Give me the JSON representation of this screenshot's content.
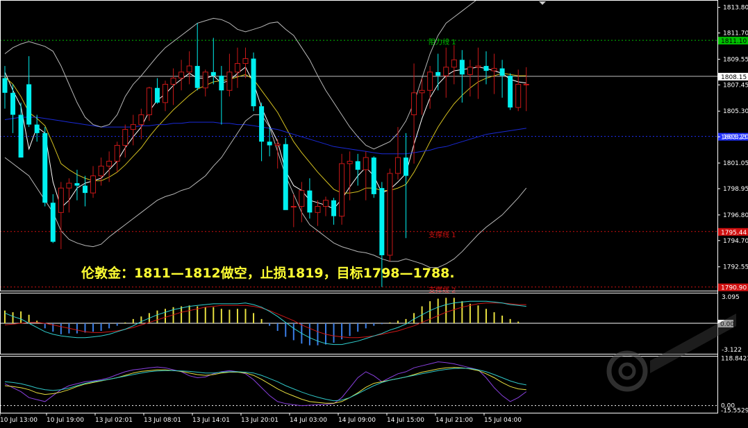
{
  "chart_data": {
    "type": "candlestick",
    "instrument_note": "伦敦金：1811—1812做空，止损1819，目标1798—1788.",
    "price_axis": {
      "ticks": [
        "1813.80",
        "1811.70",
        "1809.55",
        "1807.45",
        "1805.30",
        "1803.20",
        "1801.05",
        "1798.95",
        "1796.80",
        "1794.70",
        "1792.55"
      ],
      "ylim": [
        1790.6,
        1814.4
      ]
    },
    "time_axis": {
      "labels": [
        "10 Jul 13:00",
        "10 Jul 19:00",
        "13 Jul 02:01",
        "13 Jul 08:01",
        "13 Jul 14:01",
        "13 Jul 20:01",
        "14 Jul 03:00",
        "14 Jul 09:00",
        "14 Jul 15:00",
        "14 Jul 21:00",
        "15 Jul 04:00"
      ]
    },
    "levels": [
      {
        "name": "阻力线 1",
        "value": 1811.1,
        "label": "1811.10",
        "color": "#00c000"
      },
      {
        "name": "",
        "value": 1803.23,
        "label": "1803.23",
        "color": "#2030ff"
      },
      {
        "name": "支撑线 1",
        "value": 1795.44,
        "label": "1795.44",
        "color": "#d01010"
      },
      {
        "name": "支撑线 2",
        "value": 1790.9,
        "label": "1790.90",
        "color": "#d01010"
      }
    ],
    "current_price": {
      "value": 1808.15,
      "label": "1808.15"
    },
    "candles": [
      [
        1808.0,
        1809.0,
        1805.5,
        1806.8
      ],
      [
        1806.8,
        1807.5,
        1803.5,
        1805.0
      ],
      [
        1805.0,
        1806.0,
        1801.6,
        1801.5
      ],
      [
        1807.5,
        1809.8,
        1804.0,
        1804.2
      ],
      [
        1804.2,
        1805.0,
        1802.8,
        1803.5
      ],
      [
        1803.5,
        1804.0,
        1797.5,
        1797.8
      ],
      [
        1797.8,
        1798.5,
        1794.5,
        1794.6
      ],
      [
        1797.0,
        1799.5,
        1794.0,
        1799.0
      ],
      [
        1799.0,
        1799.8,
        1797.0,
        1799.4
      ],
      [
        1799.4,
        1800.5,
        1798.0,
        1799.2
      ],
      [
        1799.2,
        1800.0,
        1797.5,
        1798.6
      ],
      [
        1798.6,
        1800.8,
        1798.2,
        1800.0
      ],
      [
        1800.0,
        1801.5,
        1799.2,
        1800.8
      ],
      [
        1800.8,
        1802.0,
        1799.5,
        1801.2
      ],
      [
        1801.2,
        1802.8,
        1800.3,
        1802.5
      ],
      [
        1802.5,
        1804.2,
        1801.5,
        1803.8
      ],
      [
        1803.8,
        1805.0,
        1802.5,
        1804.2
      ],
      [
        1804.2,
        1805.5,
        1803.0,
        1805.0
      ],
      [
        1805.0,
        1807.3,
        1804.5,
        1807.2
      ],
      [
        1807.2,
        1808.0,
        1805.9,
        1806.0
      ],
      [
        1806.0,
        1807.8,
        1805.3,
        1807.5
      ],
      [
        1807.5,
        1808.8,
        1805.8,
        1808.0
      ],
      [
        1808.0,
        1809.5,
        1807.0,
        1808.5
      ],
      [
        1808.5,
        1810.2,
        1807.5,
        1809.0
      ],
      [
        1809.0,
        1812.5,
        1807.0,
        1807.2
      ],
      [
        1807.2,
        1808.7,
        1806.5,
        1808.5
      ],
      [
        1808.5,
        1811.3,
        1807.5,
        1808.2
      ],
      [
        1808.2,
        1809.0,
        1804.2,
        1807.0
      ],
      [
        1807.0,
        1810.0,
        1806.5,
        1808.5
      ],
      [
        1808.5,
        1810.5,
        1807.2,
        1809.2
      ],
      [
        1809.2,
        1810.5,
        1808.0,
        1809.6
      ],
      [
        1809.6,
        1810.1,
        1805.3,
        1805.7
      ],
      [
        1805.7,
        1806.0,
        1801.2,
        1802.8
      ],
      [
        1802.8,
        1804.0,
        1801.6,
        1802.5
      ],
      [
        1802.5,
        1803.0,
        1800.6,
        1802.6
      ],
      [
        1802.6,
        1803.1,
        1797.5,
        1797.2
      ],
      [
        1797.5,
        1798.5,
        1795.8,
        1797.5
      ],
      [
        1797.5,
        1799.5,
        1796.2,
        1798.8
      ],
      [
        1798.8,
        1799.8,
        1796.5,
        1797.0
      ],
      [
        1797.0,
        1798.0,
        1795.9,
        1797.5
      ],
      [
        1797.5,
        1798.3,
        1796.7,
        1798.0
      ],
      [
        1798.0,
        1798.2,
        1796.0,
        1796.7
      ],
      [
        1796.7,
        1801.8,
        1796.0,
        1801.0
      ],
      [
        1801.0,
        1802.0,
        1798.0,
        1801.2
      ],
      [
        1801.2,
        1801.8,
        1799.2,
        1800.5
      ],
      [
        1800.5,
        1802.0,
        1798.0,
        1801.5
      ],
      [
        1801.5,
        1801.6,
        1798.2,
        1798.5
      ],
      [
        1799.0,
        1799.5,
        1790.9,
        1793.5
      ],
      [
        1793.5,
        1800.6,
        1793.0,
        1800.2
      ],
      [
        1800.2,
        1804.0,
        1799.7,
        1801.5
      ],
      [
        1801.5,
        1803.5,
        1794.9,
        1800.0
      ],
      [
        1805.0,
        1809.2,
        1801.0,
        1806.8
      ],
      [
        1806.8,
        1808.0,
        1805.0,
        1807.0
      ],
      [
        1807.0,
        1809.0,
        1805.5,
        1808.5
      ],
      [
        1808.5,
        1810.0,
        1807.0,
        1808.2
      ],
      [
        1808.2,
        1810.5,
        1806.4,
        1808.9
      ],
      [
        1808.9,
        1810.7,
        1807.5,
        1809.5
      ],
      [
        1809.5,
        1810.3,
        1806.0,
        1808.3
      ],
      [
        1808.3,
        1809.5,
        1806.5,
        1808.9
      ],
      [
        1808.9,
        1810.5,
        1806.3,
        1809.0
      ],
      [
        1809.0,
        1810.2,
        1807.5,
        1808.6
      ],
      [
        1808.6,
        1810.0,
        1806.7,
        1808.8
      ],
      [
        1808.8,
        1809.5,
        1806.4,
        1808.2
      ],
      [
        1808.2,
        1808.4,
        1805.4,
        1805.6
      ],
      [
        1805.6,
        1808.7,
        1805.3,
        1807.5
      ],
      [
        1807.5,
        1808.9,
        1805.3,
        1807.5
      ]
    ],
    "series": [
      {
        "values": [
          1808.5,
          1807.0,
          1805.7,
          1802.2,
          1804.0,
          1803.5,
          1799.5,
          1797.4,
          1798.0,
          1799.0,
          1799.4,
          1799.6,
          1799.8,
          1800.5,
          1801.2,
          1802.3,
          1803.2,
          1804.0,
          1805.3,
          1806.2,
          1806.7,
          1807.4,
          1807.9,
          1808.4,
          1808.0,
          1808.0,
          1808.2,
          1807.6,
          1807.8,
          1808.4,
          1808.9,
          1807.6,
          1805.6,
          1804.1,
          1802.8,
          1800.4,
          1799.2,
          1798.8,
          1798.0,
          1797.8,
          1797.6,
          1797.3,
          1798.1,
          1799.1,
          1800.0,
          1800.7,
          1800.0,
          1798.6,
          1798.9,
          1799.5,
          1800.2,
          1802.6,
          1804.7,
          1806.4,
          1807.5,
          1808.2,
          1808.6,
          1808.7,
          1808.8,
          1808.9,
          1808.8,
          1808.6,
          1808.4,
          1807.9,
          1807.7,
          1807.6
        ]
      },
      {
        "values": [
          1808.1,
          1807.5,
          1806.5,
          1805.2,
          1804.7,
          1804.1,
          1802.6,
          1801.0,
          1800.5,
          1800.1,
          1799.8,
          1799.6,
          1799.6,
          1799.9,
          1800.3,
          1800.9,
          1801.6,
          1802.3,
          1803.2,
          1804.0,
          1804.7,
          1805.4,
          1806.0,
          1806.6,
          1807.1,
          1807.4,
          1807.7,
          1807.8,
          1807.9,
          1808.1,
          1808.3,
          1807.9,
          1807.0,
          1806.1,
          1805.2,
          1804.0,
          1802.8,
          1801.9,
          1801.1,
          1800.3,
          1799.6,
          1798.9,
          1798.6,
          1798.6,
          1798.7,
          1799.0,
          1799.0,
          1798.8,
          1798.8,
          1799.0,
          1799.3,
          1800.3,
          1801.5,
          1802.8,
          1804.0,
          1805.0,
          1805.9,
          1806.6,
          1807.2,
          1807.7,
          1808.0,
          1808.2,
          1808.4,
          1808.3,
          1808.2,
          1808.2
        ]
      },
      {
        "values": [
          1804.6,
          1804.7,
          1804.8,
          1804.8,
          1804.8,
          1804.7,
          1804.6,
          1804.5,
          1804.4,
          1804.3,
          1804.2,
          1804.1,
          1804.0,
          1804.0,
          1804.0,
          1804.0,
          1804.0,
          1804.1,
          1804.1,
          1804.2,
          1804.2,
          1804.3,
          1804.3,
          1804.4,
          1804.4,
          1804.4,
          1804.4,
          1804.3,
          1804.3,
          1804.2,
          1804.2,
          1804.1,
          1804.0,
          1803.9,
          1803.8,
          1803.6,
          1803.4,
          1803.2,
          1803.0,
          1802.8,
          1802.6,
          1802.4,
          1802.3,
          1802.2,
          1802.1,
          1802.0,
          1801.9,
          1801.8,
          1801.8,
          1801.8,
          1801.8,
          1801.9,
          1802.0,
          1802.1,
          1802.3,
          1802.4,
          1802.6,
          1802.8,
          1803.0,
          1803.2,
          1803.4,
          1803.5,
          1803.6,
          1803.7,
          1803.8,
          1803.9
        ]
      },
      {
        "values": [
          1810.0,
          1810.5,
          1810.8,
          1811.0,
          1810.8,
          1810.6,
          1810.2,
          1809.0,
          1807.5,
          1806.0,
          1804.8,
          1804.2,
          1804.0,
          1804.2,
          1805.0,
          1806.5,
          1807.5,
          1808.2,
          1809.0,
          1809.8,
          1810.5,
          1811.0,
          1811.5,
          1812.0,
          1812.5,
          1812.7,
          1812.9,
          1812.8,
          1812.5,
          1812.0,
          1811.8,
          1812.0,
          1812.2,
          1812.5,
          1812.6,
          1812.0,
          1811.5,
          1810.5,
          1809.5,
          1808.2,
          1807.0,
          1806.0,
          1805.0,
          1804.0,
          1803.2,
          1802.5,
          1802.2,
          1802.5,
          1802.8,
          1803.5,
          1804.5,
          1806.0,
          1808.0,
          1810.0,
          1811.5,
          1812.5,
          1813.0,
          1813.5,
          1814.0,
          1814.5,
          1815.0,
          1815.5,
          1815.5,
          1815.5,
          1815.5,
          1815.5
        ]
      },
      {
        "values": [
          1801.5,
          1801.0,
          1800.5,
          1800.0,
          1799.0,
          1798.0,
          1797.0,
          1795.5,
          1794.8,
          1794.5,
          1794.3,
          1794.2,
          1794.4,
          1795.0,
          1795.5,
          1796.0,
          1796.5,
          1797.0,
          1797.5,
          1798.0,
          1798.3,
          1798.5,
          1798.8,
          1799.0,
          1799.5,
          1800.0,
          1800.8,
          1801.5,
          1802.5,
          1803.5,
          1804.5,
          1805.0,
          1805.0,
          1804.0,
          1802.0,
          1800.0,
          1798.5,
          1797.0,
          1796.0,
          1795.5,
          1795.0,
          1794.5,
          1794.2,
          1794.0,
          1793.8,
          1793.7,
          1793.5,
          1793.2,
          1793.0,
          1793.0,
          1793.2,
          1793.0,
          1792.8,
          1792.5,
          1792.5,
          1792.8,
          1793.2,
          1793.8,
          1794.5,
          1795.2,
          1795.8,
          1796.3,
          1796.8,
          1797.5,
          1798.2,
          1799.0
        ]
      }
    ],
    "macd_panel": {
      "ticks": [
        "3.095",
        "0.00",
        "-3.122"
      ],
      "ylim": [
        -3.6,
        3.6
      ],
      "histogram": [
        1.5,
        1.3,
        1.4,
        1.0,
        0.3,
        -0.6,
        -1.0,
        -1.3,
        -1.2,
        -1.2,
        -1.1,
        -1.0,
        -0.9,
        -0.6,
        -0.3,
        0.1,
        0.5,
        0.8,
        1.2,
        1.5,
        1.7,
        1.9,
        2.0,
        2.1,
        2.0,
        1.9,
        1.9,
        1.7,
        1.6,
        1.7,
        1.7,
        1.2,
        0.5,
        -0.3,
        -0.9,
        -1.6,
        -2.0,
        -2.4,
        -2.6,
        -2.6,
        -2.5,
        -2.3,
        -1.9,
        -1.5,
        -1.0,
        -0.6,
        -0.3,
        -0.1,
        0.1,
        0.3,
        0.5,
        1.2,
        2.0,
        2.6,
        2.9,
        3.0,
        3.0,
        2.6,
        2.3,
        2.1,
        1.7,
        1.3,
        0.9,
        0.5,
        0.2,
        0.0
      ],
      "signal": [
        -0.2,
        -0.1,
        0.0,
        0.1,
        0.1,
        0.0,
        -0.2,
        -0.4,
        -0.6,
        -0.8,
        -1.0,
        -1.1,
        -1.1,
        -1.0,
        -0.9,
        -0.7,
        -0.5,
        -0.2,
        0.1,
        0.4,
        0.7,
        1.0,
        1.3,
        1.5,
        1.7,
        1.9,
        2.0,
        2.1,
        2.1,
        2.1,
        2.1,
        2.0,
        1.8,
        1.5,
        1.1,
        0.7,
        0.3,
        -0.2,
        -0.6,
        -1.0,
        -1.3,
        -1.5,
        -1.6,
        -1.7,
        -1.7,
        -1.6,
        -1.5,
        -1.3,
        -1.1,
        -0.9,
        -0.6,
        -0.3,
        0.1,
        0.5,
        0.9,
        1.3,
        1.6,
        1.9,
        2.1,
        2.3,
        2.4,
        2.4,
        2.4,
        2.3,
        2.2,
        2.2
      ],
      "main": [
        1.2,
        0.8,
        0.5,
        0.0,
        -0.5,
        -1.0,
        -1.3,
        -1.5,
        -1.6,
        -1.7,
        -1.7,
        -1.6,
        -1.5,
        -1.3,
        -1.0,
        -0.7,
        -0.3,
        0.2,
        0.6,
        1.0,
        1.3,
        1.6,
        1.8,
        2.0,
        2.1,
        2.2,
        2.3,
        2.3,
        2.3,
        2.3,
        2.4,
        2.2,
        1.9,
        1.4,
        0.8,
        0.1,
        -0.6,
        -1.2,
        -1.7,
        -2.1,
        -2.4,
        -2.5,
        -2.5,
        -2.3,
        -2.1,
        -1.8,
        -1.5,
        -1.2,
        -0.8,
        -0.5,
        -0.1,
        0.5,
        1.0,
        1.5,
        1.9,
        2.2,
        2.4,
        2.5,
        2.6,
        2.6,
        2.6,
        2.5,
        2.4,
        2.2,
        2.1,
        2.0
      ]
    },
    "osc_panel": {
      "ticks": [
        "118.8423",
        "0.00",
        "-15.5529"
      ],
      "ylim": [
        -18,
        125
      ],
      "series": [
        {
          "values": [
            55,
            45,
            35,
            20,
            15,
            10,
            25,
            40,
            50,
            55,
            60,
            62,
            65,
            70,
            78,
            85,
            90,
            92,
            95,
            97,
            95,
            90,
            85,
            75,
            70,
            72,
            80,
            85,
            88,
            85,
            80,
            65,
            45,
            25,
            10,
            5,
            2,
            0,
            1,
            2,
            3,
            5,
            20,
            45,
            70,
            85,
            75,
            60,
            70,
            80,
            85,
            95,
            100,
            105,
            110,
            108,
            105,
            100,
            95,
            90,
            70,
            45,
            25,
            10,
            20,
            35
          ]
        },
        {
          "values": [
            50,
            48,
            45,
            40,
            32,
            28,
            30,
            34,
            40,
            48,
            54,
            58,
            62,
            66,
            70,
            76,
            82,
            86,
            88,
            90,
            90,
            88,
            86,
            82,
            78,
            76,
            78,
            82,
            84,
            84,
            82,
            76,
            66,
            54,
            42,
            32,
            24,
            16,
            10,
            8,
            6,
            6,
            10,
            20,
            32,
            46,
            56,
            60,
            64,
            68,
            72,
            78,
            84,
            88,
            92,
            95,
            96,
            95,
            92,
            88,
            80,
            70,
            58,
            48,
            42,
            40
          ]
        },
        {
          "values": [
            60,
            58,
            55,
            50,
            44,
            40,
            38,
            40,
            44,
            50,
            56,
            60,
            63,
            66,
            70,
            74,
            78,
            82,
            85,
            87,
            88,
            88,
            87,
            86,
            84,
            82,
            82,
            84,
            85,
            85,
            84,
            82,
            76,
            68,
            60,
            50,
            42,
            34,
            27,
            21,
            16,
            12,
            14,
            20,
            30,
            40,
            50,
            58,
            64,
            68,
            72,
            76,
            80,
            84,
            88,
            91,
            93,
            94,
            93,
            90,
            85,
            78,
            70,
            62,
            56,
            52
          ]
        }
      ]
    }
  }
}
